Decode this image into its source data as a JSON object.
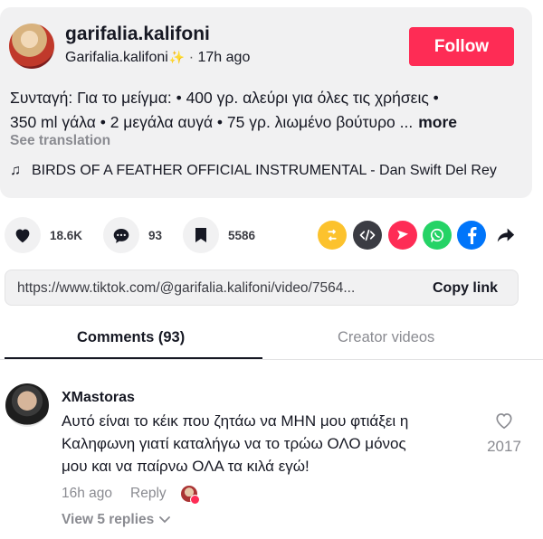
{
  "post": {
    "username": "garifalia.kalifoni",
    "nickname": "Garifalia.kalifoni",
    "sparkle": "✨",
    "separator": "·",
    "time_ago": "17h ago",
    "follow_label": "Follow",
    "description_line1": "Συνταγή: Για το μείγμα: • 400 γρ. αλεύρι για όλες τις χρήσεις •",
    "description_line2": "350 ml γάλα • 2 μεγάλα αυγά • 75 γρ. λιωμένο βούτυρο ...",
    "more_label": "more",
    "see_translation": "See translation",
    "music_icon": "♫",
    "music": "BIRDS OF A FEATHER OFFICIAL INSTRUMENTAL - Dan Swift Del Rey"
  },
  "actions": {
    "likes": "18.6K",
    "comments": "93",
    "saves": "5586"
  },
  "share_icons": [
    "repost-icon",
    "embed-icon",
    "send-icon",
    "whatsapp-icon",
    "facebook-icon",
    "share-arrow-icon"
  ],
  "colors": {
    "accent": "#fe2c55",
    "repost": "#fcc22d",
    "embed": "#3b3c43",
    "send": "#fe2c55",
    "whatsapp": "#25d366",
    "facebook": "#0075fa"
  },
  "link": {
    "url": "https://www.tiktok.com/@garifalia.kalifoni/video/7564...",
    "copy_label": "Copy link"
  },
  "tabs": {
    "comments": "Comments (93)",
    "creator": "Creator videos"
  },
  "comment": {
    "author": "XMastoras",
    "text_line1": "Αυτό είναι το κέικ που ζητάω να ΜΗΝ μου φτιάξει η",
    "text_line2": "Καληφωνη γιατί καταλήγω να το τρώω ΟΛΟ μόνος",
    "text_line3": "μου και να παίρνω ΟΛΑ τα κιλά εγώ!",
    "time": "16h ago",
    "reply_label": "Reply",
    "likes": "2017",
    "view_replies": "View 5 replies"
  }
}
